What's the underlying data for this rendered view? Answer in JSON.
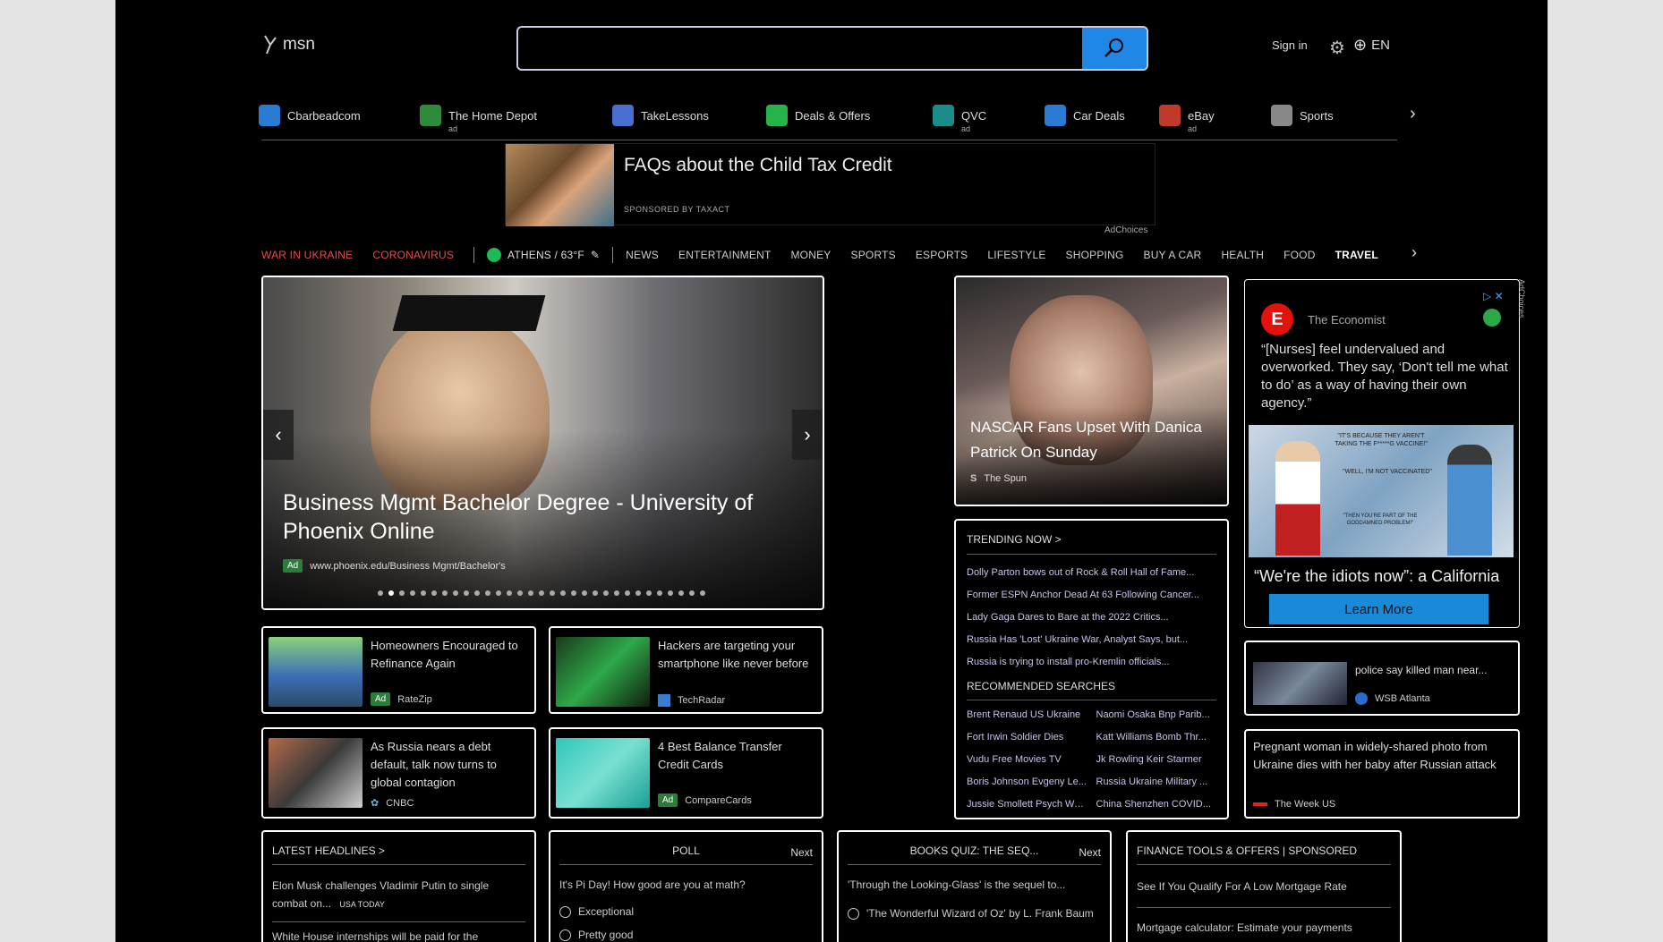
{
  "header": {
    "logo_text": "msn",
    "search_value": "",
    "signin_label": "Sign in",
    "lang_label": "EN"
  },
  "quick_links": [
    {
      "label": "Cbarbeadcom",
      "ad": "",
      "color": "#2a7bd1",
      "icon": "web-icon"
    },
    {
      "label": "The Home Depot",
      "ad": "ad",
      "color": "#2e8b3a",
      "icon": "home-depot-icon"
    },
    {
      "label": "TakeLessons",
      "ad": "",
      "color": "#4a6ed0",
      "icon": "lessons-icon"
    },
    {
      "label": "Deals & Offers",
      "ad": "",
      "color": "#25b34a",
      "icon": "tag-icon"
    },
    {
      "label": "QVC",
      "ad": "ad",
      "color": "#1a8c8c",
      "icon": "qvc-icon"
    },
    {
      "label": "Car Deals",
      "ad": "",
      "color": "#2a7bd1",
      "icon": "car-icon"
    },
    {
      "label": "eBay",
      "ad": "ad",
      "color": "#c0392b",
      "icon": "shopping-bag-icon"
    },
    {
      "label": "Sports",
      "ad": "",
      "color": "#888888",
      "icon": "ball-icon"
    }
  ],
  "banner": {
    "title": "FAQs about the Child Tax Credit",
    "sponsor": "SPONSORED BY TAXACT",
    "adchoices": "AdChoices"
  },
  "nav": {
    "red_items": [
      "WAR IN UKRAINE",
      "CORONAVIRUS"
    ],
    "weather": "ATHENS / 63°F",
    "items": [
      "NEWS",
      "ENTERTAINMENT",
      "MONEY",
      "SPORTS",
      "ESPORTS",
      "LIFESTYLE",
      "SHOPPING",
      "BUY A CAR",
      "HEALTH",
      "FOOD"
    ],
    "bold_item": "TRAVEL"
  },
  "hero": {
    "title": "Business Mgmt Bachelor Degree - University of Phoenix Online",
    "ad_badge": "Ad",
    "url": "www.phoenix.edu/Business Mgmt/Bachelor's",
    "dots": 31,
    "active_dot": 1
  },
  "feature": {
    "title": "NASCAR Fans Upset With Danica Patrick On Sunday",
    "source": "The Spun"
  },
  "small_cards": [
    {
      "title": "Homeowners Encouraged to Refinance Again",
      "source": "RateZip",
      "ad": "Ad",
      "thumb": "linear-gradient(180deg,#8bd17a,#3e6fb5 55%,#2b4a6b)"
    },
    {
      "title": "Hackers are targeting your smartphone like never before",
      "source": "TechRadar",
      "ad": "",
      "thumb": "linear-gradient(135deg,#1a3a1a,#2fa84a 50%,#0d1f0d)"
    },
    {
      "title": "As Russia nears a debt default, talk now turns to global contagion",
      "source": "CNBC",
      "ad": "",
      "thumb": "linear-gradient(135deg,#b46a4a,#3a3a3a 50%,#d0d0d0)"
    },
    {
      "title": "4 Best Balance Transfer Credit Cards",
      "source": "CompareCards",
      "ad": "Ad",
      "thumb": "linear-gradient(135deg,#2fc7b8,#7ae0d3 50%,#1a9f94)"
    }
  ],
  "trending": {
    "heading": "TRENDING NOW >",
    "items": [
      "Dolly Parton bows out of Rock & Roll Hall of Fame...",
      "Former ESPN Anchor Dead At 63 Following Cancer...",
      "Lady Gaga Dares to Bare at the 2022 Critics...",
      "Russia Has 'Lost' Ukraine War, Analyst Says, but...",
      "Russia is trying to install pro-Kremlin officials..."
    ],
    "rec_heading": "RECOMMENDED SEARCHES",
    "searches": [
      "Brent Renaud US Ukraine",
      "Naomi Osaka Bnp Parib...",
      "Fort Irwin Soldier Dies",
      "Katt Williams Bomb Thr...",
      "Vudu Free Movies TV",
      "Jk Rowling Keir Starmer",
      "Boris Johnson Evgeny Le...",
      "Russia Ukraine Military ...",
      "Jussie Smollett Psych Wa...",
      "China Shenzhen COVID..."
    ]
  },
  "economist": {
    "brand": "The Economist",
    "quote": "“[Nurses] feel undervalued and overworked. They say, ‘Don't tell me what to do’ as a way of having their own agency.”",
    "caption": "“We're the idiots now”: a California doctor on his...",
    "cta": "Learn More",
    "adchoices": "AdChoices",
    "bubble1": "\"IT'S BECAUSE THEY AREN'T TAKING THE F*****G VACCINE!\"",
    "bubble2": "\"WELL, I'M NOT VACCINATED\"",
    "bubble3": "\"THEN YOU'RE PART OF THE GODDAMNED PROBLEM!\""
  },
  "wsb": {
    "title": "police say killed man near...",
    "source": "WSB Atlanta"
  },
  "week": {
    "title": "Pregnant woman in widely-shared photo from Ukraine dies with her baby after Russian attack",
    "source": "The Week US"
  },
  "headlines": {
    "heading": "LATEST HEADLINES >",
    "item1": "Elon Musk challenges Vladimir Putin to single combat on...",
    "item1_src": "USA TODAY",
    "item2": "White House internships will be paid for the"
  },
  "poll": {
    "heading": "POLL",
    "next": "Next",
    "question": "It's Pi Day! How good are you at math?",
    "options": [
      "Exceptional",
      "Pretty good"
    ]
  },
  "quiz": {
    "heading": "BOOKS QUIZ: THE SEQ...",
    "next": "Next",
    "question": "'Through the Looking-Glass' is the sequel to...",
    "option": "'The Wonderful Wizard of Oz' by L. Frank Baum"
  },
  "finance": {
    "heading": "FINANCE TOOLS & OFFERS | SPONSORED",
    "item1": "See If You Qualify For A Low Mortgage Rate",
    "item2": "Mortgage calculator: Estimate your payments"
  }
}
